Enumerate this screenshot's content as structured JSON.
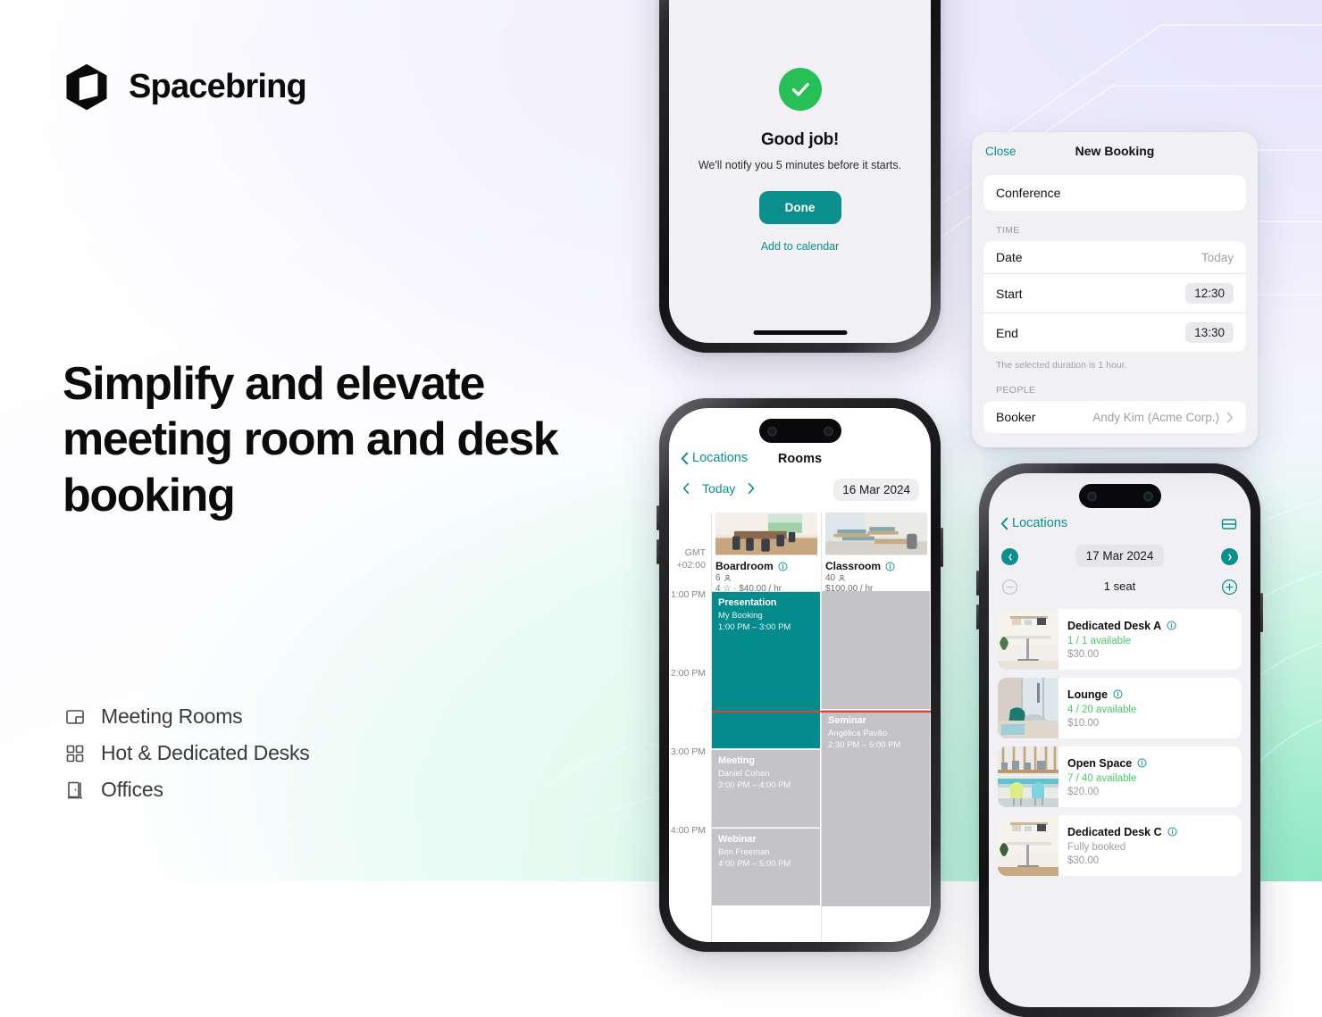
{
  "brand": {
    "name": "Spacebring",
    "logo_icon": "spacebring-cube-logo"
  },
  "headline": "Simplify and elevate meeting room and desk booking",
  "features": [
    {
      "icon": "meeting-room-icon",
      "label": "Meeting Rooms"
    },
    {
      "icon": "grid-desks-icon",
      "label": "Hot & Dedicated Desks"
    },
    {
      "icon": "office-door-icon",
      "label": "Offices"
    }
  ],
  "colors": {
    "teal": "#0a8f8c",
    "event_teal": "#048b8b",
    "success_green": "#27c056",
    "available_green": "#4cc76a",
    "busy_grey": "#c4c4c8",
    "now_line_red": "#ef3b33"
  },
  "confirmation_screen": {
    "check_icon": "checkmark-circle-icon",
    "title": "Good job!",
    "subtitle": "We'll notify you 5 minutes before it starts.",
    "primary_button": "Done",
    "secondary_link": "Add to calendar"
  },
  "booking_card": {
    "close_label": "Close",
    "title": "New Booking",
    "resource_value": "Conference",
    "time_section_label": "TIME",
    "rows": [
      {
        "label": "Date",
        "value": "Today",
        "style": "plain"
      },
      {
        "label": "Start",
        "value": "12:30",
        "style": "chip"
      },
      {
        "label": "End",
        "value": "13:30",
        "style": "chip"
      }
    ],
    "duration_note": "The selected duration is 1 hour.",
    "people_section_label": "PEOPLE",
    "booker_label": "Booker",
    "booker_value": "Andy Kim (Acme Corp.)",
    "chevron_icon": "chevron-right-icon"
  },
  "rooms_screen": {
    "back_label": "Locations",
    "back_icon": "chevron-left-icon",
    "title": "Rooms",
    "prev_icon": "chevron-left-icon",
    "today_label": "Today",
    "next_icon": "chevron-right-icon",
    "date_pill": "16 Mar 2024",
    "timezone": "GMT\n+02:00",
    "timezone_line1": "GMT",
    "timezone_line2": "+02:00",
    "hours": [
      "1:00 PM",
      "2:00 PM",
      "3:00 PM",
      "4:00 PM"
    ],
    "rooms": [
      {
        "name": "Boardroom",
        "info_icon": "info-circle-icon",
        "capacity": "6",
        "capacity_icon": "person-icon",
        "rating_line": "4 ☆ · $40.00 / hr",
        "photo": "boardroom-photo"
      },
      {
        "name": "Classroom",
        "info_icon": "info-circle-icon",
        "capacity": "40",
        "capacity_icon": "person-icon",
        "rating_line": "$100.00 / hr",
        "photo": "classroom-photo"
      }
    ],
    "events": [
      {
        "column": 0,
        "title": "Presentation",
        "person": "My Booking",
        "time": "1:00 PM – 3:00 PM",
        "kind": "mine"
      },
      {
        "column": 0,
        "title": "Meeting",
        "person": "Daniel Cohen",
        "time": "3:00 PM – 4:00 PM",
        "kind": "busy"
      },
      {
        "column": 0,
        "title": "Webinar",
        "person": "Ben Freeman",
        "time": "4:00 PM – 5:00 PM",
        "kind": "busy"
      },
      {
        "column": 1,
        "title": "Seminar",
        "person": "Angélica Pavão",
        "time": "2:30 PM – 5:00 PM",
        "kind": "busy"
      }
    ]
  },
  "desks_screen": {
    "back_label": "Locations",
    "back_icon": "chevron-left-icon",
    "layout_icon": "layout-rows-icon",
    "prev_icon": "chevron-left-circle-icon",
    "date_pill": "17 Mar 2024",
    "next_icon": "chevron-right-circle-icon",
    "minus_icon": "minus-circle-icon",
    "seat_count": "1 seat",
    "plus_icon": "plus-circle-icon",
    "desks": [
      {
        "name": "Dedicated Desk A",
        "info_icon": "info-circle-icon",
        "availability": "1 / 1 available",
        "available": true,
        "price": "$30.00",
        "photo": "desk-a-photo"
      },
      {
        "name": "Lounge",
        "info_icon": "info-circle-icon",
        "availability": "4 / 20 available",
        "available": true,
        "price": "$10.00",
        "photo": "lounge-photo"
      },
      {
        "name": "Open Space",
        "info_icon": "info-circle-icon",
        "availability": "7 / 40 available",
        "available": true,
        "price": "$20.00",
        "photo": "openspace-photo"
      },
      {
        "name": "Dedicated Desk C",
        "info_icon": "info-circle-icon",
        "availability": "Fully booked",
        "available": false,
        "price": "$30.00",
        "photo": "desk-c-photo"
      }
    ]
  }
}
